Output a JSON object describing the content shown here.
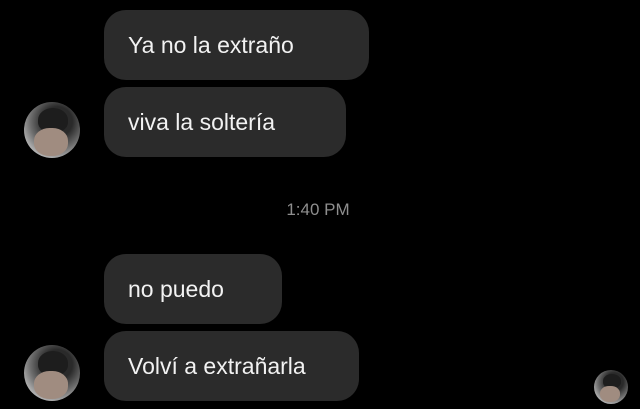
{
  "messages_group_1": [
    {
      "text": "Ya no la extraño"
    },
    {
      "text": "viva la soltería"
    }
  ],
  "timestamp": "1:40 PM",
  "messages_group_2": [
    {
      "text": "no puedo"
    },
    {
      "text": "Volví a extrañarla"
    }
  ],
  "colors": {
    "background": "#000000",
    "bubble": "#2b2b2b",
    "text": "#f2f2f2",
    "timestamp": "#8e8e8e"
  }
}
